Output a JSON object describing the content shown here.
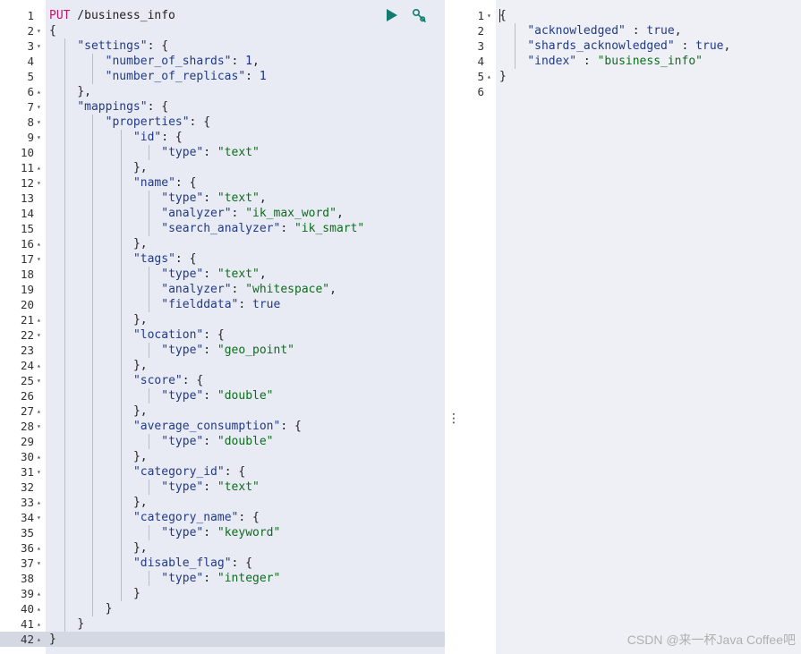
{
  "request": {
    "method": "PUT",
    "path": " /business_info",
    "run_icon": "play-icon",
    "settings_icon": "wrench-icon",
    "lines": [
      {
        "n": "1",
        "fold": "",
        "indent": 0,
        "tokens": [
          [
            "method",
            "PUT"
          ],
          [
            "punc",
            " /business_info"
          ]
        ]
      },
      {
        "n": "2",
        "fold": "▾",
        "indent": 0,
        "tokens": [
          [
            "punc",
            "{"
          ]
        ]
      },
      {
        "n": "3",
        "fold": "▾",
        "indent": 1,
        "tokens": [
          [
            "key",
            "\"settings\""
          ],
          [
            "punc",
            ": {"
          ]
        ]
      },
      {
        "n": "4",
        "fold": "",
        "indent": 2,
        "tokens": [
          [
            "key",
            "\"number_of_shards\""
          ],
          [
            "punc",
            ": "
          ],
          [
            "num",
            "1"
          ],
          [
            "punc",
            ","
          ]
        ]
      },
      {
        "n": "5",
        "fold": "",
        "indent": 2,
        "tokens": [
          [
            "key",
            "\"number_of_replicas\""
          ],
          [
            "punc",
            ": "
          ],
          [
            "num",
            "1"
          ]
        ]
      },
      {
        "n": "6",
        "fold": "▴",
        "indent": 1,
        "tokens": [
          [
            "punc",
            "},"
          ]
        ]
      },
      {
        "n": "7",
        "fold": "▾",
        "indent": 1,
        "tokens": [
          [
            "key",
            "\"mappings\""
          ],
          [
            "punc",
            ": {"
          ]
        ]
      },
      {
        "n": "8",
        "fold": "▾",
        "indent": 2,
        "tokens": [
          [
            "key",
            "\"properties\""
          ],
          [
            "punc",
            ": {"
          ]
        ]
      },
      {
        "n": "9",
        "fold": "▾",
        "indent": 3,
        "tokens": [
          [
            "key",
            "\"id\""
          ],
          [
            "punc",
            ": {"
          ]
        ]
      },
      {
        "n": "10",
        "fold": "",
        "indent": 4,
        "tokens": [
          [
            "key",
            "\"type\""
          ],
          [
            "punc",
            ": "
          ],
          [
            "str",
            "\"text\""
          ]
        ]
      },
      {
        "n": "11",
        "fold": "▴",
        "indent": 3,
        "tokens": [
          [
            "punc",
            "},"
          ]
        ]
      },
      {
        "n": "12",
        "fold": "▾",
        "indent": 3,
        "tokens": [
          [
            "key",
            "\"name\""
          ],
          [
            "punc",
            ": {"
          ]
        ]
      },
      {
        "n": "13",
        "fold": "",
        "indent": 4,
        "tokens": [
          [
            "key",
            "\"type\""
          ],
          [
            "punc",
            ": "
          ],
          [
            "str",
            "\"text\""
          ],
          [
            "punc",
            ","
          ]
        ]
      },
      {
        "n": "14",
        "fold": "",
        "indent": 4,
        "tokens": [
          [
            "key",
            "\"analyzer\""
          ],
          [
            "punc",
            ": "
          ],
          [
            "str",
            "\"ik_max_word\""
          ],
          [
            "punc",
            ","
          ]
        ]
      },
      {
        "n": "15",
        "fold": "",
        "indent": 4,
        "tokens": [
          [
            "key",
            "\"search_analyzer\""
          ],
          [
            "punc",
            ": "
          ],
          [
            "str",
            "\"ik_smart\""
          ]
        ]
      },
      {
        "n": "16",
        "fold": "▴",
        "indent": 3,
        "tokens": [
          [
            "punc",
            "},"
          ]
        ]
      },
      {
        "n": "17",
        "fold": "▾",
        "indent": 3,
        "tokens": [
          [
            "key",
            "\"tags\""
          ],
          [
            "punc",
            ": {"
          ]
        ]
      },
      {
        "n": "18",
        "fold": "",
        "indent": 4,
        "tokens": [
          [
            "key",
            "\"type\""
          ],
          [
            "punc",
            ": "
          ],
          [
            "str",
            "\"text\""
          ],
          [
            "punc",
            ","
          ]
        ]
      },
      {
        "n": "19",
        "fold": "",
        "indent": 4,
        "tokens": [
          [
            "key",
            "\"analyzer\""
          ],
          [
            "punc",
            ": "
          ],
          [
            "str",
            "\"whitespace\""
          ],
          [
            "punc",
            ","
          ]
        ]
      },
      {
        "n": "20",
        "fold": "",
        "indent": 4,
        "tokens": [
          [
            "key",
            "\"fielddata\""
          ],
          [
            "punc",
            ": "
          ],
          [
            "bool",
            "true"
          ]
        ]
      },
      {
        "n": "21",
        "fold": "▴",
        "indent": 3,
        "tokens": [
          [
            "punc",
            "},"
          ]
        ]
      },
      {
        "n": "22",
        "fold": "▾",
        "indent": 3,
        "tokens": [
          [
            "key",
            "\"location\""
          ],
          [
            "punc",
            ": {"
          ]
        ]
      },
      {
        "n": "23",
        "fold": "",
        "indent": 4,
        "tokens": [
          [
            "key",
            "\"type\""
          ],
          [
            "punc",
            ": "
          ],
          [
            "str",
            "\"geo_point\""
          ]
        ]
      },
      {
        "n": "24",
        "fold": "▴",
        "indent": 3,
        "tokens": [
          [
            "punc",
            "},"
          ]
        ]
      },
      {
        "n": "25",
        "fold": "▾",
        "indent": 3,
        "tokens": [
          [
            "key",
            "\"score\""
          ],
          [
            "punc",
            ": {"
          ]
        ]
      },
      {
        "n": "26",
        "fold": "",
        "indent": 4,
        "tokens": [
          [
            "key",
            "\"type\""
          ],
          [
            "punc",
            ": "
          ],
          [
            "str",
            "\"double\""
          ]
        ]
      },
      {
        "n": "27",
        "fold": "▴",
        "indent": 3,
        "tokens": [
          [
            "punc",
            "},"
          ]
        ]
      },
      {
        "n": "28",
        "fold": "▾",
        "indent": 3,
        "tokens": [
          [
            "key",
            "\"average_consumption\""
          ],
          [
            "punc",
            ": {"
          ]
        ]
      },
      {
        "n": "29",
        "fold": "",
        "indent": 4,
        "tokens": [
          [
            "key",
            "\"type\""
          ],
          [
            "punc",
            ": "
          ],
          [
            "str",
            "\"double\""
          ]
        ]
      },
      {
        "n": "30",
        "fold": "▴",
        "indent": 3,
        "tokens": [
          [
            "punc",
            "},"
          ]
        ]
      },
      {
        "n": "31",
        "fold": "▾",
        "indent": 3,
        "tokens": [
          [
            "key",
            "\"category_id\""
          ],
          [
            "punc",
            ": {"
          ]
        ]
      },
      {
        "n": "32",
        "fold": "",
        "indent": 4,
        "tokens": [
          [
            "key",
            "\"type\""
          ],
          [
            "punc",
            ": "
          ],
          [
            "str",
            "\"text\""
          ]
        ]
      },
      {
        "n": "33",
        "fold": "▴",
        "indent": 3,
        "tokens": [
          [
            "punc",
            "},"
          ]
        ]
      },
      {
        "n": "34",
        "fold": "▾",
        "indent": 3,
        "tokens": [
          [
            "key",
            "\"category_name\""
          ],
          [
            "punc",
            ": {"
          ]
        ]
      },
      {
        "n": "35",
        "fold": "",
        "indent": 4,
        "tokens": [
          [
            "key",
            "\"type\""
          ],
          [
            "punc",
            ": "
          ],
          [
            "str",
            "\"keyword\""
          ]
        ]
      },
      {
        "n": "36",
        "fold": "▴",
        "indent": 3,
        "tokens": [
          [
            "punc",
            "},"
          ]
        ]
      },
      {
        "n": "37",
        "fold": "▾",
        "indent": 3,
        "tokens": [
          [
            "key",
            "\"disable_flag\""
          ],
          [
            "punc",
            ": {"
          ]
        ]
      },
      {
        "n": "38",
        "fold": "",
        "indent": 4,
        "tokens": [
          [
            "key",
            "\"type\""
          ],
          [
            "punc",
            ": "
          ],
          [
            "str",
            "\"integer\""
          ]
        ]
      },
      {
        "n": "39",
        "fold": "▴",
        "indent": 3,
        "tokens": [
          [
            "punc",
            "}"
          ]
        ]
      },
      {
        "n": "40",
        "fold": "▴",
        "indent": 2,
        "tokens": [
          [
            "punc",
            "}"
          ]
        ]
      },
      {
        "n": "41",
        "fold": "▴",
        "indent": 1,
        "tokens": [
          [
            "punc",
            "}"
          ]
        ]
      },
      {
        "n": "42",
        "fold": "▴",
        "indent": 0,
        "tokens": [
          [
            "punc",
            "}"
          ]
        ]
      }
    ]
  },
  "response": {
    "lines": [
      {
        "n": "1",
        "fold": "▾",
        "indent": 0,
        "tokens": [
          [
            "punc",
            "{"
          ]
        ]
      },
      {
        "n": "2",
        "fold": "",
        "indent": 1,
        "tokens": [
          [
            "key",
            "\"acknowledged\""
          ],
          [
            "punc",
            " : "
          ],
          [
            "bool",
            "true"
          ],
          [
            "punc",
            ","
          ]
        ]
      },
      {
        "n": "3",
        "fold": "",
        "indent": 1,
        "tokens": [
          [
            "key",
            "\"shards_acknowledged\""
          ],
          [
            "punc",
            " : "
          ],
          [
            "bool",
            "true"
          ],
          [
            "punc",
            ","
          ]
        ]
      },
      {
        "n": "4",
        "fold": "",
        "indent": 1,
        "tokens": [
          [
            "key",
            "\"index\""
          ],
          [
            "punc",
            " : "
          ],
          [
            "str",
            "\"business_info\""
          ]
        ]
      },
      {
        "n": "5",
        "fold": "▴",
        "indent": 0,
        "tokens": [
          [
            "punc",
            "}"
          ]
        ]
      },
      {
        "n": "6",
        "fold": "",
        "indent": 0,
        "tokens": []
      }
    ]
  },
  "divider_handle": "⋮",
  "watermark": "CSDN @来一杯Java Coffee吧",
  "colors": {
    "key": "#213a86",
    "string": "#0f6b1e",
    "method": "#c0136c",
    "run_button": "#127b6e"
  }
}
